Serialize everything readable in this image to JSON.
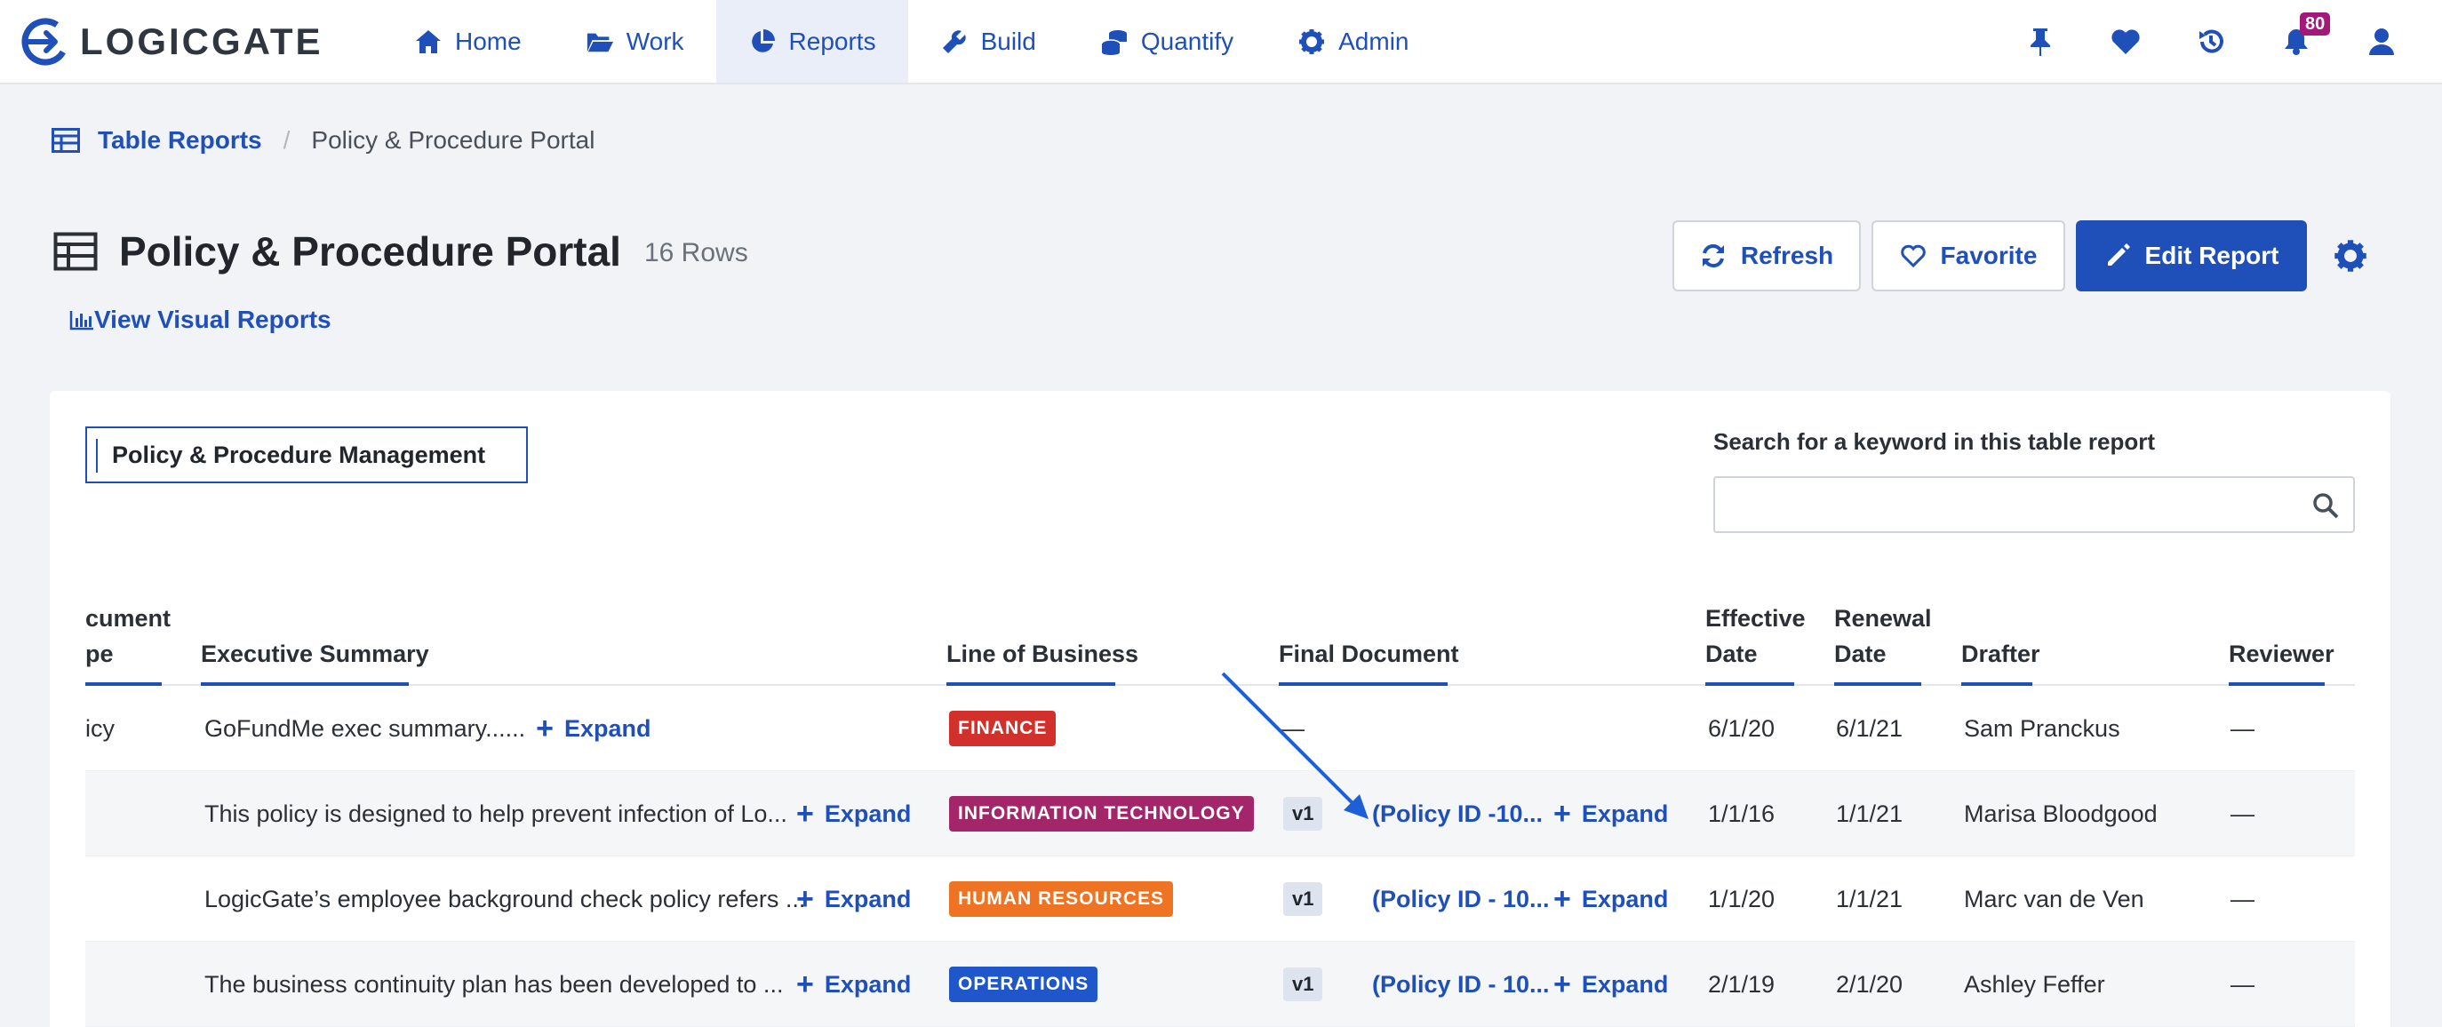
{
  "brand": {
    "name": "LOGICGATE",
    "color": "#1f4fb8"
  },
  "nav": [
    {
      "label": "Home",
      "icon": "home-icon"
    },
    {
      "label": "Work",
      "icon": "folder-icon"
    },
    {
      "label": "Reports",
      "icon": "pie-chart-icon",
      "active": true
    },
    {
      "label": "Build",
      "icon": "wrench-icon"
    },
    {
      "label": "Quantify",
      "icon": "coins-icon"
    },
    {
      "label": "Admin",
      "icon": "gear-icon"
    }
  ],
  "right_icons": [
    "pin-icon",
    "heart-icon",
    "history-icon",
    "bell-icon",
    "user-icon"
  ],
  "notifications": {
    "count": "80"
  },
  "breadcrumb": {
    "parent": "Table Reports",
    "separator": "/",
    "current": "Policy & Procedure Portal"
  },
  "page": {
    "title": "Policy & Procedure Portal",
    "row_count": "16 Rows",
    "visual_link": "View Visual Reports"
  },
  "actions": {
    "refresh": "Refresh",
    "favorite": "Favorite",
    "edit": "Edit Report"
  },
  "workflow_tab": "Policy & Procedure Management",
  "search": {
    "label": "Search for a keyword in this table report",
    "value": "",
    "placeholder": ""
  },
  "table": {
    "headers": {
      "doc_type": "cument\npe",
      "summary": "Executive Summary",
      "lob": "Line of Business",
      "final_doc": "Final Document",
      "effective": "Effective\nDate",
      "renewal": "Renewal\nDate",
      "drafter": "Drafter",
      "reviewer": "Reviewer"
    },
    "expand_label": "Expand",
    "rows": [
      {
        "doc_type": "icy",
        "summary": "GoFundMe exec summary......",
        "lob": "FINANCE",
        "lob_color": "#d2302b",
        "final_doc": "—",
        "version": "",
        "effective": "6/1/20",
        "renewal": "6/1/21",
        "drafter": "Sam Pranckus",
        "reviewer": "—"
      },
      {
        "doc_type": "",
        "summary": "This policy is designed to help prevent infection of Lo...",
        "lob": "INFORMATION TECHNOLOGY",
        "lob_color": "#a3266b",
        "final_doc": "(Policy ID -10...",
        "version": "v1",
        "effective": "1/1/16",
        "renewal": "1/1/21",
        "drafter": "Marisa Bloodgood",
        "reviewer": "—"
      },
      {
        "doc_type": "",
        "summary": "LogicGate’s employee background check policy refers ...",
        "lob": "HUMAN RESOURCES",
        "lob_color": "#ee7423",
        "final_doc": "(Policy ID - 10...",
        "version": "v1",
        "effective": "1/1/20",
        "renewal": "1/1/21",
        "drafter": "Marc van de Ven",
        "reviewer": "—"
      },
      {
        "doc_type": "",
        "summary": "The business continuity plan has been developed to ...",
        "lob": "OPERATIONS",
        "lob_color": "#1f56c9",
        "final_doc": "(Policy ID - 10...",
        "version": "v1",
        "effective": "2/1/19",
        "renewal": "2/1/20",
        "drafter": "Ashley Feffer",
        "reviewer": "—"
      }
    ]
  }
}
